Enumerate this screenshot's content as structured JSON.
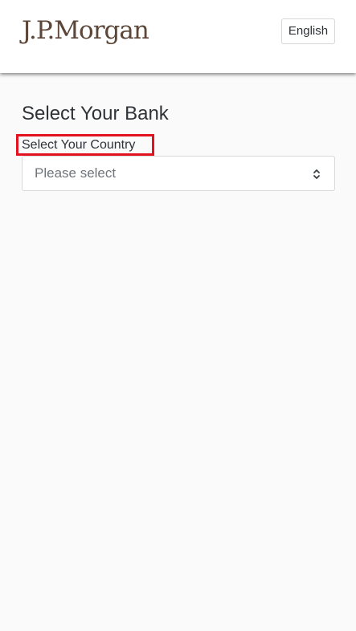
{
  "header": {
    "logo_text": "J.P.Morgan",
    "language_button": "English"
  },
  "main": {
    "title": "Select Your Bank",
    "country_field": {
      "label": "Select Your Country",
      "value": "Please select"
    }
  },
  "colors": {
    "logo": "#5c4638",
    "highlight_border": "#e2131f",
    "text": "#2f3338",
    "placeholder": "#6f757b",
    "page_background": "#fafafa"
  },
  "icons": {
    "select_arrow": "chevron-up-down-icon"
  }
}
